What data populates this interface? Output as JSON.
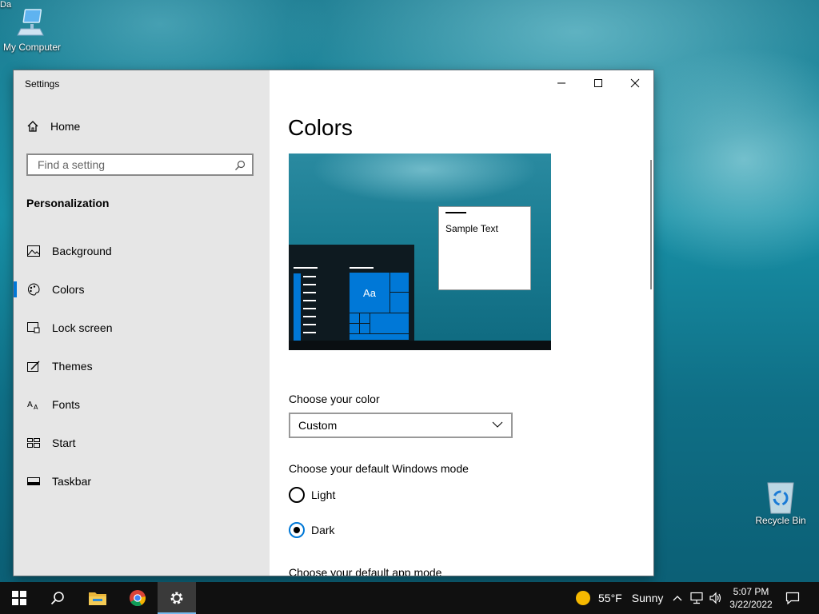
{
  "desktop": {
    "my_computer_label": "My Computer",
    "recycle_bin_label": "Recycle Bin",
    "partial_label": "Da"
  },
  "window": {
    "title": "Settings",
    "controls": [
      "minimize-icon",
      "maximize-icon",
      "close-icon"
    ]
  },
  "sidebar": {
    "home_label": "Home",
    "search_placeholder": "Find a setting",
    "section_label": "Personalization",
    "items": [
      {
        "label": "Background",
        "icon": "picture-icon"
      },
      {
        "label": "Colors",
        "icon": "palette-icon",
        "active": true
      },
      {
        "label": "Lock screen",
        "icon": "lock-screen-icon"
      },
      {
        "label": "Themes",
        "icon": "themes-icon"
      },
      {
        "label": "Fonts",
        "icon": "fonts-icon"
      },
      {
        "label": "Start",
        "icon": "start-icon"
      },
      {
        "label": "Taskbar",
        "icon": "taskbar-icon"
      }
    ]
  },
  "content": {
    "title": "Colors",
    "preview": {
      "sample_text": "Sample Text",
      "tile_text": "Aa"
    },
    "choose_color_label": "Choose your color",
    "choose_color_value": "Custom",
    "windows_mode_label": "Choose your default Windows mode",
    "windows_mode_options": [
      {
        "label": "Light",
        "checked": false
      },
      {
        "label": "Dark",
        "checked": true
      }
    ],
    "app_mode_label": "Choose your default app mode"
  },
  "taskbar": {
    "weather_temp": "55°F",
    "weather_cond": "Sunny",
    "time": "5:07 PM",
    "date": "3/22/2022",
    "apps": [
      "windows-start-icon",
      "search-icon",
      "file-explorer-icon",
      "chrome-icon",
      "settings-gear-icon"
    ]
  },
  "colors": {
    "accent": "#0078d7",
    "taskbar": "#101010",
    "sidebar": "#e6e6e6"
  }
}
